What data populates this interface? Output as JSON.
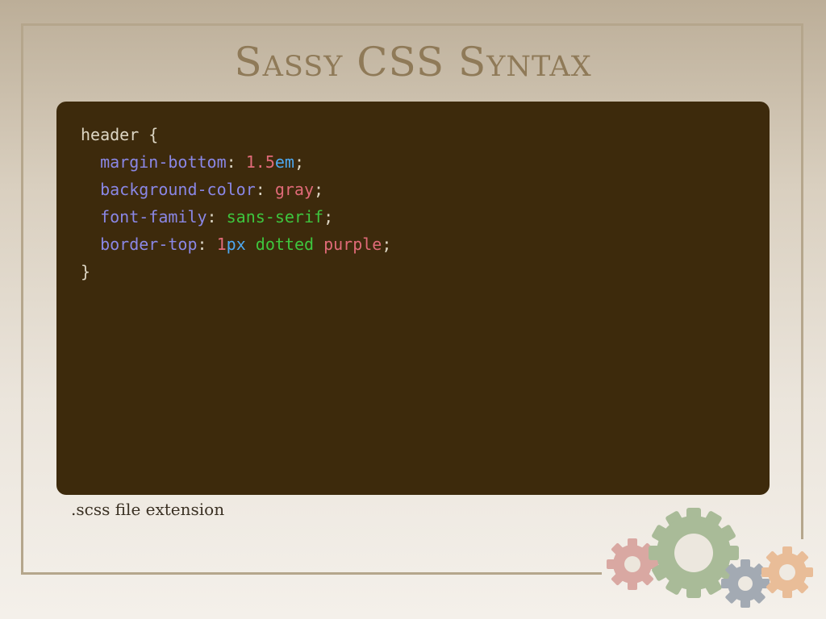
{
  "slide": {
    "title": "Sassy CSS Syntax",
    "caption": ".scss file extension"
  },
  "code": {
    "selector": "header",
    "open_brace": "{",
    "close_brace": "}",
    "colon": ":",
    "semicolon": ";",
    "indent": "  ",
    "space": " ",
    "lines": [
      {
        "prop": "margin-bottom",
        "number": "1.5",
        "unit": "em"
      },
      {
        "prop": "background-color",
        "value": "gray"
      },
      {
        "prop": "font-family",
        "value": "sans-serif"
      },
      {
        "prop": "border-top",
        "number": "1",
        "unit": "px",
        "value2": "dotted",
        "value3": "purple"
      }
    ]
  },
  "colors": {
    "panel_background": "#3d2a0c",
    "property": "#8a87e6",
    "number": "#e06a78",
    "unit": "#4da8f0",
    "keyword": "#e06a78",
    "string": "#3ec63e",
    "title": "#8f7a58"
  },
  "decoration": {
    "icons": [
      "gear-icon-pink",
      "gear-icon-green",
      "gear-icon-slate",
      "gear-icon-orange"
    ]
  }
}
